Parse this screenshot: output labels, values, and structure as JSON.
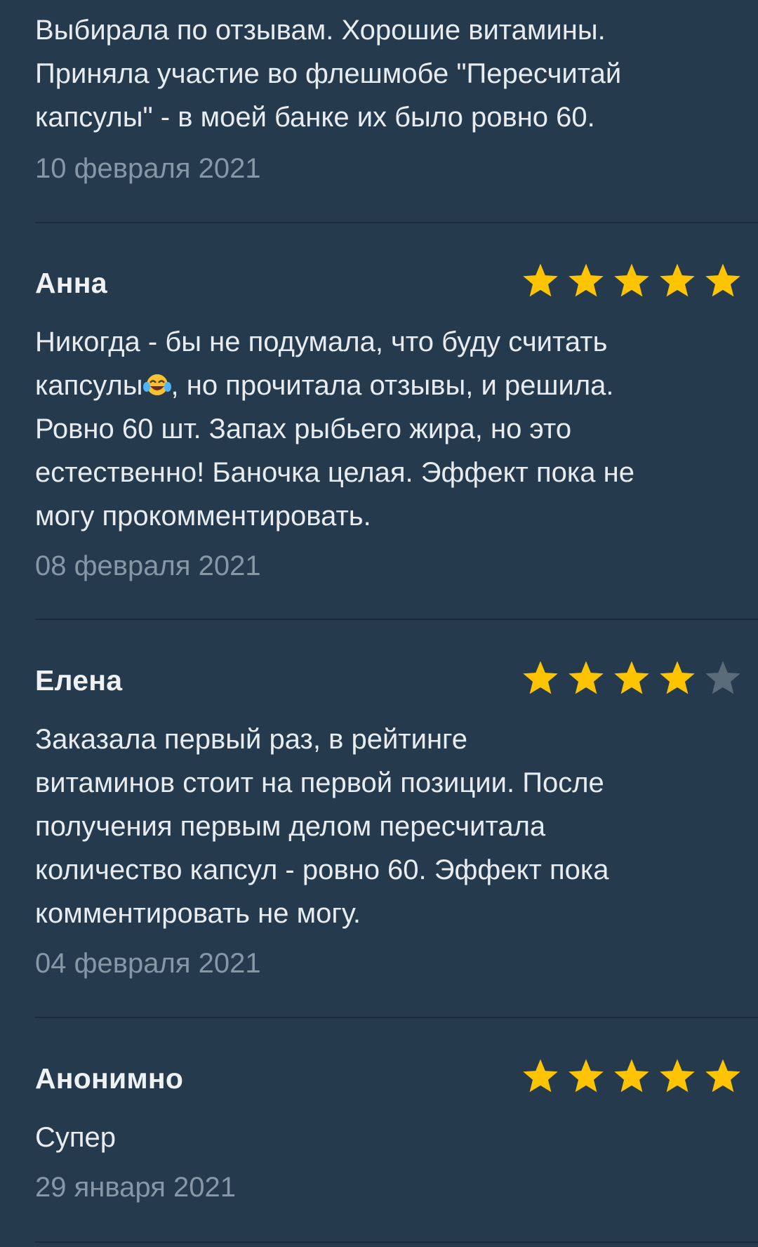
{
  "reviews": [
    {
      "text": "Выбирала по отзывам. Хорошие витамины.\nПриняла участие во флешмобе \"Пересчитай\nкапсулы\" - в моей банке их было ровно 60.",
      "date": "10 февраля 2021"
    },
    {
      "author": "Анна",
      "rating": 5,
      "text_before_emoji": "Никогда - бы не подумала, что буду считать\nкапсулы",
      "emoji": "😂",
      "text_after_emoji": ", но прочитала отзывы, и решила.\nРовно 60 шт. Запах рыбьего жира, но это\nестественно! Баночка целая. Эффект пока не\nмогу прокомментировать.",
      "date": "08 февраля 2021"
    },
    {
      "author": "Елена",
      "rating": 4,
      "text": "Заказала первый раз, в рейтинге\nвитаминов стоит на первой позиции. После\nполучения первым делом пересчитала\nколичество капсул - ровно 60. Эффект пока\nкомментировать не могу.",
      "date": "04 февраля 2021"
    },
    {
      "author": "Анонимно",
      "rating": 5,
      "text": "Супер",
      "date": "29 января 2021"
    }
  ],
  "colors": {
    "background": "#263a4d",
    "star_filled": "#ffc400",
    "star_empty": "#5a6b7a",
    "date_text": "#8697a6",
    "divider": "#1b2b39"
  },
  "icons": {
    "star": "star-icon",
    "emoji": "tears-of-joy-emoji-icon"
  }
}
